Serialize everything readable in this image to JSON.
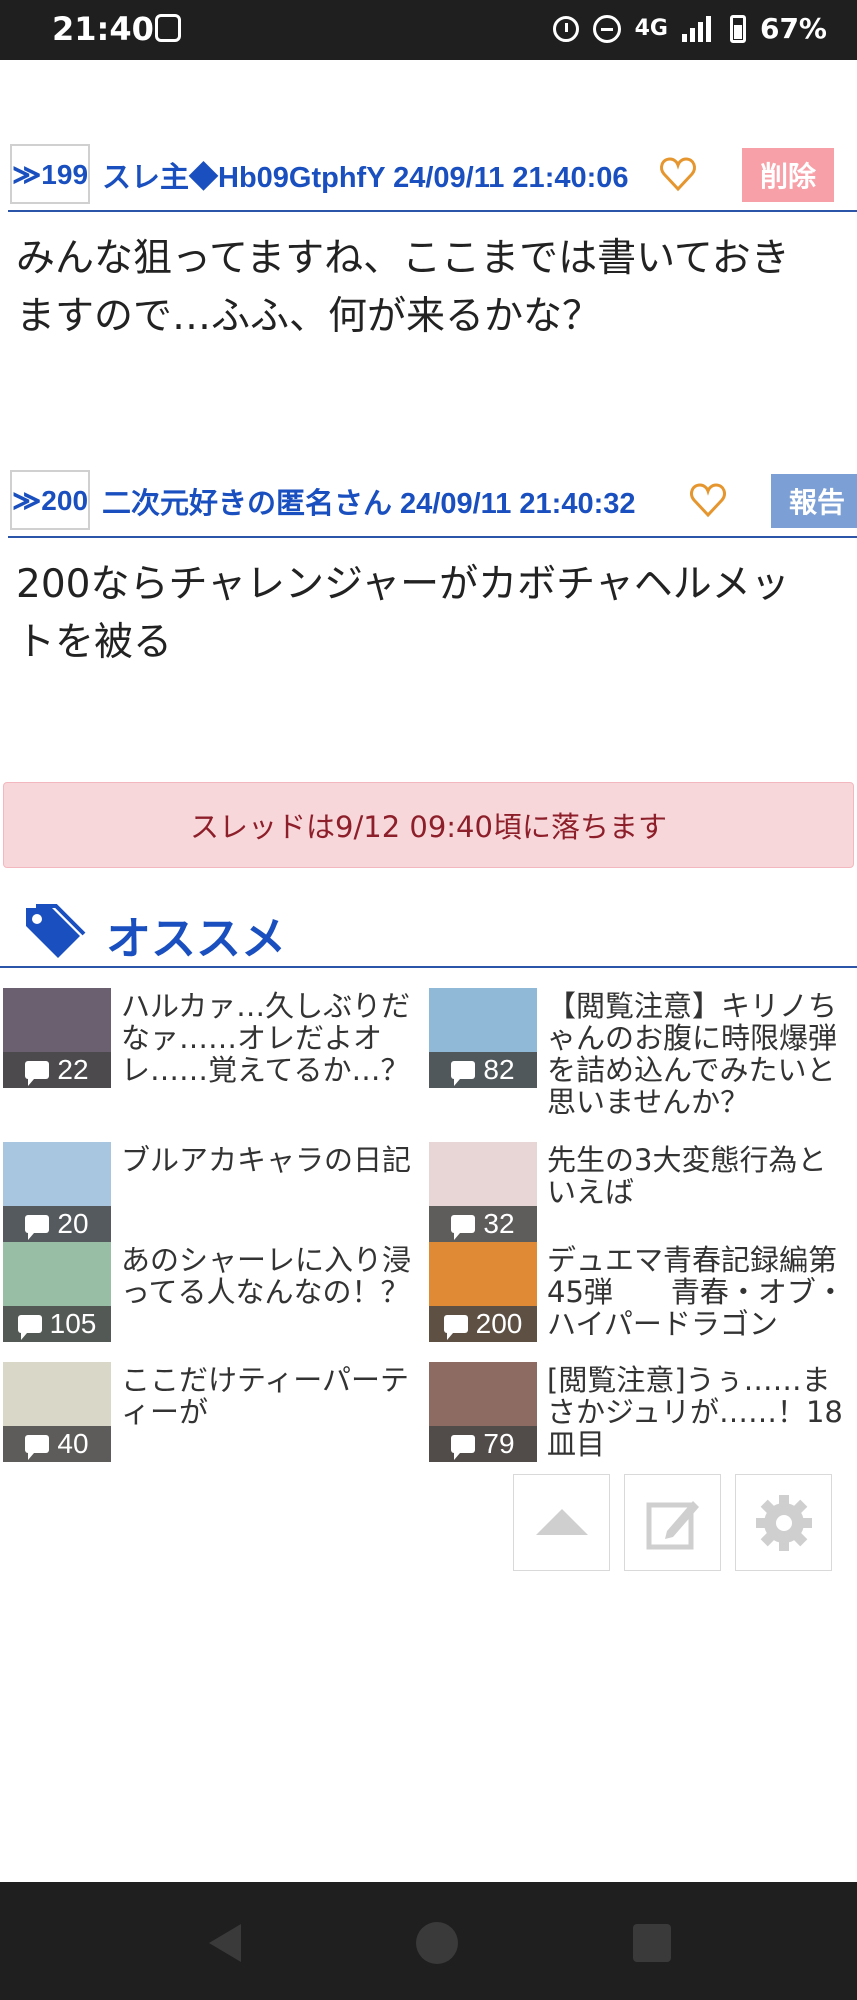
{
  "status_bar": {
    "time": "21:40",
    "network": "4G",
    "battery": "67%"
  },
  "posts": [
    {
      "number": "≫199",
      "meta": "スレ主◆Hb09GtphfY 24/09/11 21:40:06",
      "action": "削除",
      "action_color": "#f7a0a7",
      "body": "みんな狙ってますね、ここまでは書いておきますので…ふふ、何が来るかな？"
    },
    {
      "number": "≫200",
      "meta": "二次元好きの匿名さん 24/09/11 21:40:32",
      "action": "報告",
      "action_color": "#7c9fd6",
      "body": "200ならチャレンジャーがカボチャヘルメットを被る"
    }
  ],
  "notice": "スレッドは9/12 09:40頃に落ちます",
  "recommend": {
    "title": "オススメ",
    "items": [
      {
        "count": "22",
        "title": "ハルカァ…久しぶりだなァ……オレだよオレ……覚えてるか…？",
        "color": "#6b6070"
      },
      {
        "count": "82",
        "title": "【閲覧注意】キリノちゃんのお腹に時限爆弾を詰め込んでみたいと思いませんか？",
        "color": "#8fb9d6"
      },
      {
        "count": "20",
        "title": "ブルアカキャラの日記",
        "color": "#a9c6e0"
      },
      {
        "count": "32",
        "title": "先生の3大変態行為といえば",
        "color": "#e8d6d6"
      },
      {
        "count": "105",
        "title": "あのシャーレに入り浸ってる人なんなの！？",
        "color": "#98bfa6"
      },
      {
        "count": "200",
        "title": "デュエマ青春記録編第45弾　　青春・オブ・ハイパードラゴン",
        "color": "#e08a35"
      },
      {
        "count": "40",
        "title": "ここだけティーパーティーが",
        "color": "#d9d8c8"
      },
      {
        "count": "79",
        "title": "[閲覧注意]うぅ……まさかジュリが……！18皿目",
        "color": "#8d6b62"
      }
    ]
  }
}
